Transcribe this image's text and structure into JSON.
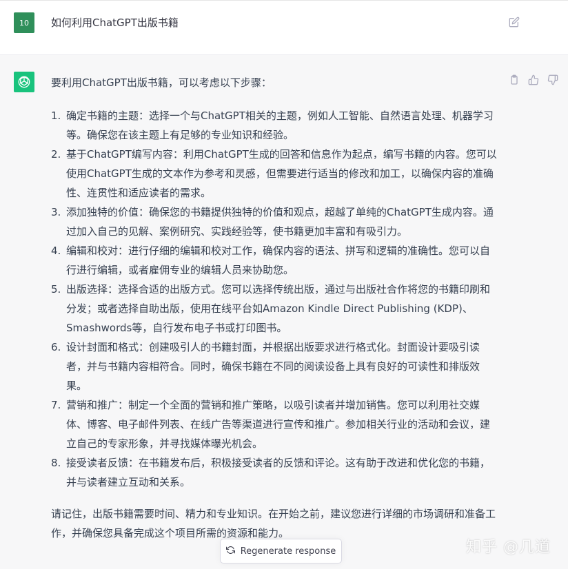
{
  "user_message": {
    "avatar_text": "10",
    "text": "如何利用ChatGPT出版书籍"
  },
  "assistant_message": {
    "intro": "要利用ChatGPT出版书籍，可以考虑以下步骤：",
    "steps": [
      "确定书籍的主题：选择一个与ChatGPT相关的主题，例如人工智能、自然语言处理、机器学习等。确保您在该主题上有足够的专业知识和经验。",
      "基于ChatGPT编写内容：利用ChatGPT生成的回答和信息作为起点，编写书籍的内容。您可以使用ChatGPT生成的文本作为参考和灵感，但需要进行适当的修改和加工，以确保内容的准确性、连贯性和适应读者的需求。",
      "添加独特的价值：确保您的书籍提供独特的价值和观点，超越了单纯的ChatGPT生成内容。通过加入自己的见解、案例研究、实践经验等，使书籍更加丰富和有吸引力。",
      "编辑和校对：进行仔细的编辑和校对工作，确保内容的语法、拼写和逻辑的准确性。您可以自行进行编辑，或者雇佣专业的编辑人员来协助您。",
      "出版选择：选择合适的出版方式。您可以选择传统出版，通过与出版社合作将您的书籍印刷和分发；或者选择自助出版，使用在线平台如Amazon Kindle Direct Publishing (KDP)、Smashwords等，自行发布电子书或打印图书。",
      "设计封面和格式：创建吸引人的书籍封面，并根据出版要求进行格式化。封面设计要吸引读者，并与书籍内容相符合。同时，确保书籍在不同的阅读设备上具有良好的可读性和排版效果。",
      "营销和推广：制定一个全面的营销和推广策略，以吸引读者并增加销售。您可以利用社交媒体、博客、电子邮件列表、在线广告等渠道进行宣传和推广。参加相关行业的活动和会议，建立自己的专家形象，并寻找媒体曝光机会。",
      "接受读者反馈：在书籍发布后，积极接受读者的反馈和评论。这有助于改进和优化您的书籍，并与读者建立互动和关系。"
    ],
    "outro": "请记住，出版书籍需要时间、精力和专业知识。在开始之前，建议您进行详细的市场调研和准备工作，并确保您具备完成这个项目所需的资源和能力。"
  },
  "regenerate_label": "Regenerate response",
  "watermark": "知乎 @几道",
  "icons": {
    "edit": "edit-icon",
    "copy": "clipboard-icon",
    "like": "thumbs-up-icon",
    "dislike": "thumbs-down-icon",
    "regenerate": "refresh-icon",
    "assistant_avatar": "openai-logo-icon"
  },
  "colors": {
    "assistant_avatar_bg": "#19c37d",
    "user_avatar_bg": "#2f8f5a",
    "assistant_row_bg": "#f7f7f8"
  }
}
